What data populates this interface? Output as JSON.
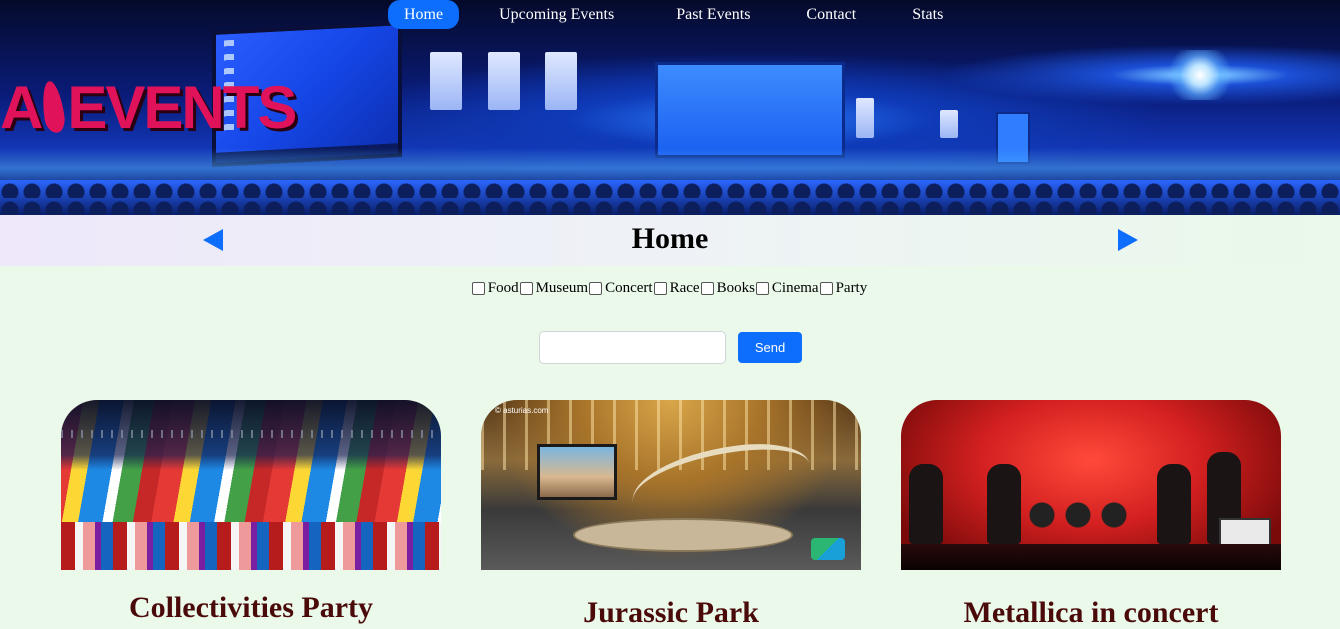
{
  "header": {
    "logo_text": "EVENTS",
    "logo_letter": "A"
  },
  "nav": {
    "items": [
      {
        "label": "Home",
        "active": true
      },
      {
        "label": "Upcoming Events",
        "active": false
      },
      {
        "label": "Past Events",
        "active": false
      },
      {
        "label": "Contact",
        "active": false
      },
      {
        "label": "Stats",
        "active": false
      }
    ]
  },
  "main": {
    "title": "Home",
    "prev_icon": "triangle-left-icon",
    "next_icon": "triangle-right-icon"
  },
  "filters": [
    {
      "label": "Food",
      "checked": false
    },
    {
      "label": "Museum",
      "checked": false
    },
    {
      "label": "Concert",
      "checked": false
    },
    {
      "label": "Race",
      "checked": false
    },
    {
      "label": "Books",
      "checked": false
    },
    {
      "label": "Cinema",
      "checked": false
    },
    {
      "label": "Party",
      "checked": false
    }
  ],
  "search": {
    "value": "",
    "placeholder": "",
    "button_label": "Send"
  },
  "cards": [
    {
      "title": "Collectivities Party",
      "image": "party-flags-photo"
    },
    {
      "title": "Jurassic Park",
      "image": "museum-dinosaur-photo",
      "caption": "© asturias.com"
    },
    {
      "title": "Metallica in concert",
      "image": "concert-stage-photo"
    }
  ],
  "colors": {
    "accent": "#0d6efd",
    "page_bg": "#eaf9ea",
    "card_title": "#4a0a0a",
    "logo": "#e0135a"
  }
}
